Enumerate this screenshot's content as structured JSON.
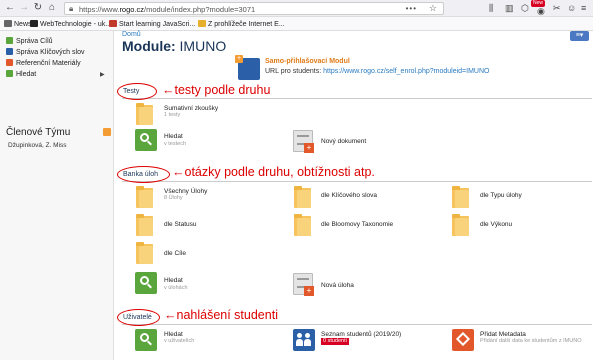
{
  "browser": {
    "url_prefix": "https://www.",
    "url_domain": "rogo.cz",
    "url_path": "/module/index.php?module=3071",
    "new_badge": "New"
  },
  "bookmarks": [
    {
      "label": "News",
      "color": "#666666"
    },
    {
      "label": "WebTechnologie - uk...",
      "color": "#222222"
    },
    {
      "label": "Start learning JavaScri...",
      "color": "#c0392b"
    },
    {
      "label": "Z prohlížeče Internet E...",
      "color": "#e6b02e"
    }
  ],
  "sidebar": {
    "items": [
      {
        "label": "Správa Cílů",
        "color": "#5aa53c"
      },
      {
        "label": "Správa Klíčových slov",
        "color": "#2b5fa8"
      },
      {
        "label": "Referenční Materiály",
        "color": "#e3582b"
      },
      {
        "label": "Hledat",
        "color": "#5aa53c"
      }
    ],
    "members_title": "Členové Týmu",
    "member": "Džupinková, Z. Miss"
  },
  "main": {
    "breadcrumb": "Domů",
    "title_prefix": "Module:",
    "title_name": "IMUNO",
    "module_link": "Samo-přihlašovací Modul",
    "url_label": "URL pro students:",
    "url_value": "https://www.rogo.cz/self_enrol.php?moduleid=IMUNO"
  },
  "sections": {
    "testy": {
      "label": "Testy",
      "annotation": "←testy podle druhu",
      "folder_label": "Sumativní zkoušky",
      "folder_sub": "1 testy",
      "search_label": "Hledat",
      "search_sub": "v testech",
      "newdoc_label": "Nový dokument"
    },
    "banka": {
      "label": "Banka úloh",
      "annotation": "←otázky podle druhu, obtížnosti atp.",
      "folders": [
        {
          "label": "Všechny Úlohy",
          "sub": "8 Úlohy"
        },
        {
          "label": "dle Klíčového slova",
          "sub": ""
        },
        {
          "label": "dle Typu úlohy",
          "sub": ""
        },
        {
          "label": "dle Statusu",
          "sub": ""
        },
        {
          "label": "dle Bloomovy Taxonomie",
          "sub": ""
        },
        {
          "label": "dle Výkonu",
          "sub": ""
        },
        {
          "label": "dle Cíle",
          "sub": ""
        }
      ],
      "search_label": "Hledat",
      "search_sub": "v úlohách",
      "new_label": "Nová úloha"
    },
    "uzivatele": {
      "label": "Uživatelé",
      "annotation": "←nahlášení studenti",
      "search_label": "Hledat",
      "search_sub": "v uživatelích",
      "students_label": "Seznam studentů (2019/20)",
      "students_badge": "0 studenti",
      "metadata_label": "Přidat Metadata",
      "metadata_sub": "Přidání další data ke studentům z IMUNO"
    }
  }
}
